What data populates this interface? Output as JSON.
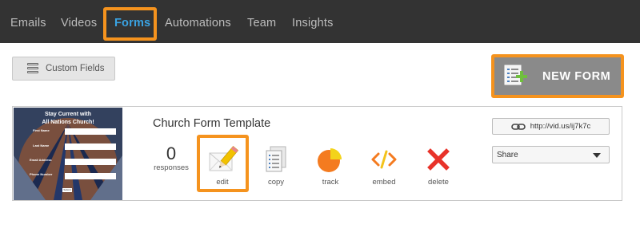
{
  "nav": {
    "items": [
      {
        "label": "Emails"
      },
      {
        "label": "Videos"
      },
      {
        "label": "Forms",
        "active": true
      },
      {
        "label": "Automations"
      },
      {
        "label": "Team"
      },
      {
        "label": "Insights"
      }
    ]
  },
  "toolbar": {
    "custom_fields_label": "Custom Fields",
    "new_form_label": "NEW FORM"
  },
  "form_card": {
    "title": "Church Form Template",
    "responses_count": "0",
    "responses_label": "responses",
    "actions": [
      {
        "label": "edit",
        "icon": "envelope-pencil-icon"
      },
      {
        "label": "copy",
        "icon": "copy-icon"
      },
      {
        "label": "track",
        "icon": "pie-chart-icon"
      },
      {
        "label": "embed",
        "icon": "code-icon"
      },
      {
        "label": "delete",
        "icon": "delete-x-icon"
      }
    ],
    "url": "http://vid.us/ij7k7c",
    "share_label": "Share",
    "thumbnail": {
      "title_line1": "Stay Current with",
      "title_line2": "All Nations Church!",
      "fields": [
        "First Name",
        "Last Name",
        "Email Address",
        "Phone Number"
      ],
      "submit_label": "Submit"
    }
  },
  "colors": {
    "nav_bg": "#333333",
    "nav_active": "#3aa3e3",
    "highlight": "#f5931e",
    "new_form_bg": "#8a8a8a",
    "delete_red": "#e8332a",
    "track_orange": "#f47b20",
    "track_yellow": "#f3d31b"
  }
}
